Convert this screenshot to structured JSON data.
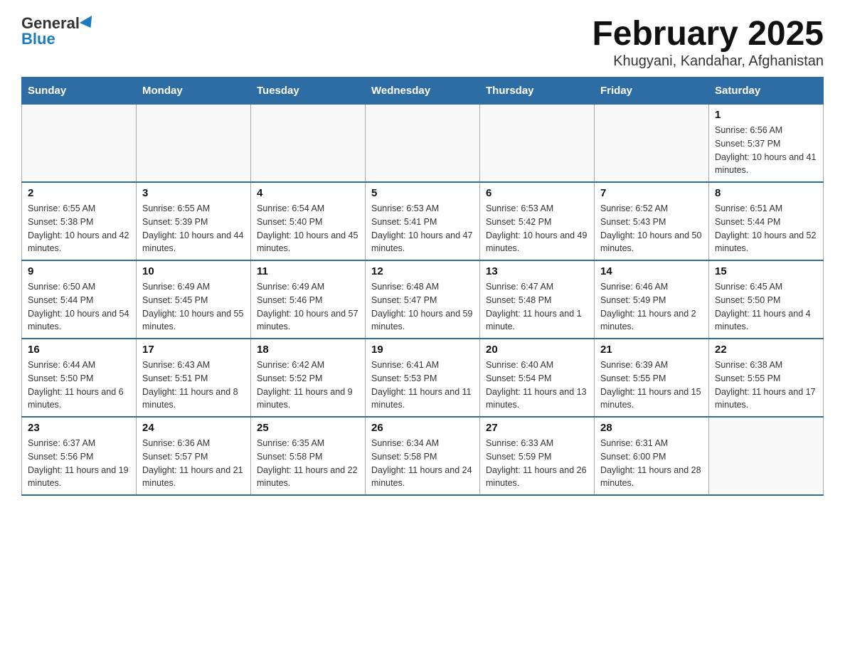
{
  "logo": {
    "general": "General",
    "blue": "Blue"
  },
  "title": "February 2025",
  "subtitle": "Khugyani, Kandahar, Afghanistan",
  "days_of_week": [
    "Sunday",
    "Monday",
    "Tuesday",
    "Wednesday",
    "Thursday",
    "Friday",
    "Saturday"
  ],
  "weeks": [
    [
      {
        "day": "",
        "info": ""
      },
      {
        "day": "",
        "info": ""
      },
      {
        "day": "",
        "info": ""
      },
      {
        "day": "",
        "info": ""
      },
      {
        "day": "",
        "info": ""
      },
      {
        "day": "",
        "info": ""
      },
      {
        "day": "1",
        "info": "Sunrise: 6:56 AM\nSunset: 5:37 PM\nDaylight: 10 hours and 41 minutes."
      }
    ],
    [
      {
        "day": "2",
        "info": "Sunrise: 6:55 AM\nSunset: 5:38 PM\nDaylight: 10 hours and 42 minutes."
      },
      {
        "day": "3",
        "info": "Sunrise: 6:55 AM\nSunset: 5:39 PM\nDaylight: 10 hours and 44 minutes."
      },
      {
        "day": "4",
        "info": "Sunrise: 6:54 AM\nSunset: 5:40 PM\nDaylight: 10 hours and 45 minutes."
      },
      {
        "day": "5",
        "info": "Sunrise: 6:53 AM\nSunset: 5:41 PM\nDaylight: 10 hours and 47 minutes."
      },
      {
        "day": "6",
        "info": "Sunrise: 6:53 AM\nSunset: 5:42 PM\nDaylight: 10 hours and 49 minutes."
      },
      {
        "day": "7",
        "info": "Sunrise: 6:52 AM\nSunset: 5:43 PM\nDaylight: 10 hours and 50 minutes."
      },
      {
        "day": "8",
        "info": "Sunrise: 6:51 AM\nSunset: 5:44 PM\nDaylight: 10 hours and 52 minutes."
      }
    ],
    [
      {
        "day": "9",
        "info": "Sunrise: 6:50 AM\nSunset: 5:44 PM\nDaylight: 10 hours and 54 minutes."
      },
      {
        "day": "10",
        "info": "Sunrise: 6:49 AM\nSunset: 5:45 PM\nDaylight: 10 hours and 55 minutes."
      },
      {
        "day": "11",
        "info": "Sunrise: 6:49 AM\nSunset: 5:46 PM\nDaylight: 10 hours and 57 minutes."
      },
      {
        "day": "12",
        "info": "Sunrise: 6:48 AM\nSunset: 5:47 PM\nDaylight: 10 hours and 59 minutes."
      },
      {
        "day": "13",
        "info": "Sunrise: 6:47 AM\nSunset: 5:48 PM\nDaylight: 11 hours and 1 minute."
      },
      {
        "day": "14",
        "info": "Sunrise: 6:46 AM\nSunset: 5:49 PM\nDaylight: 11 hours and 2 minutes."
      },
      {
        "day": "15",
        "info": "Sunrise: 6:45 AM\nSunset: 5:50 PM\nDaylight: 11 hours and 4 minutes."
      }
    ],
    [
      {
        "day": "16",
        "info": "Sunrise: 6:44 AM\nSunset: 5:50 PM\nDaylight: 11 hours and 6 minutes."
      },
      {
        "day": "17",
        "info": "Sunrise: 6:43 AM\nSunset: 5:51 PM\nDaylight: 11 hours and 8 minutes."
      },
      {
        "day": "18",
        "info": "Sunrise: 6:42 AM\nSunset: 5:52 PM\nDaylight: 11 hours and 9 minutes."
      },
      {
        "day": "19",
        "info": "Sunrise: 6:41 AM\nSunset: 5:53 PM\nDaylight: 11 hours and 11 minutes."
      },
      {
        "day": "20",
        "info": "Sunrise: 6:40 AM\nSunset: 5:54 PM\nDaylight: 11 hours and 13 minutes."
      },
      {
        "day": "21",
        "info": "Sunrise: 6:39 AM\nSunset: 5:55 PM\nDaylight: 11 hours and 15 minutes."
      },
      {
        "day": "22",
        "info": "Sunrise: 6:38 AM\nSunset: 5:55 PM\nDaylight: 11 hours and 17 minutes."
      }
    ],
    [
      {
        "day": "23",
        "info": "Sunrise: 6:37 AM\nSunset: 5:56 PM\nDaylight: 11 hours and 19 minutes."
      },
      {
        "day": "24",
        "info": "Sunrise: 6:36 AM\nSunset: 5:57 PM\nDaylight: 11 hours and 21 minutes."
      },
      {
        "day": "25",
        "info": "Sunrise: 6:35 AM\nSunset: 5:58 PM\nDaylight: 11 hours and 22 minutes."
      },
      {
        "day": "26",
        "info": "Sunrise: 6:34 AM\nSunset: 5:58 PM\nDaylight: 11 hours and 24 minutes."
      },
      {
        "day": "27",
        "info": "Sunrise: 6:33 AM\nSunset: 5:59 PM\nDaylight: 11 hours and 26 minutes."
      },
      {
        "day": "28",
        "info": "Sunrise: 6:31 AM\nSunset: 6:00 PM\nDaylight: 11 hours and 28 minutes."
      },
      {
        "day": "",
        "info": ""
      }
    ]
  ]
}
